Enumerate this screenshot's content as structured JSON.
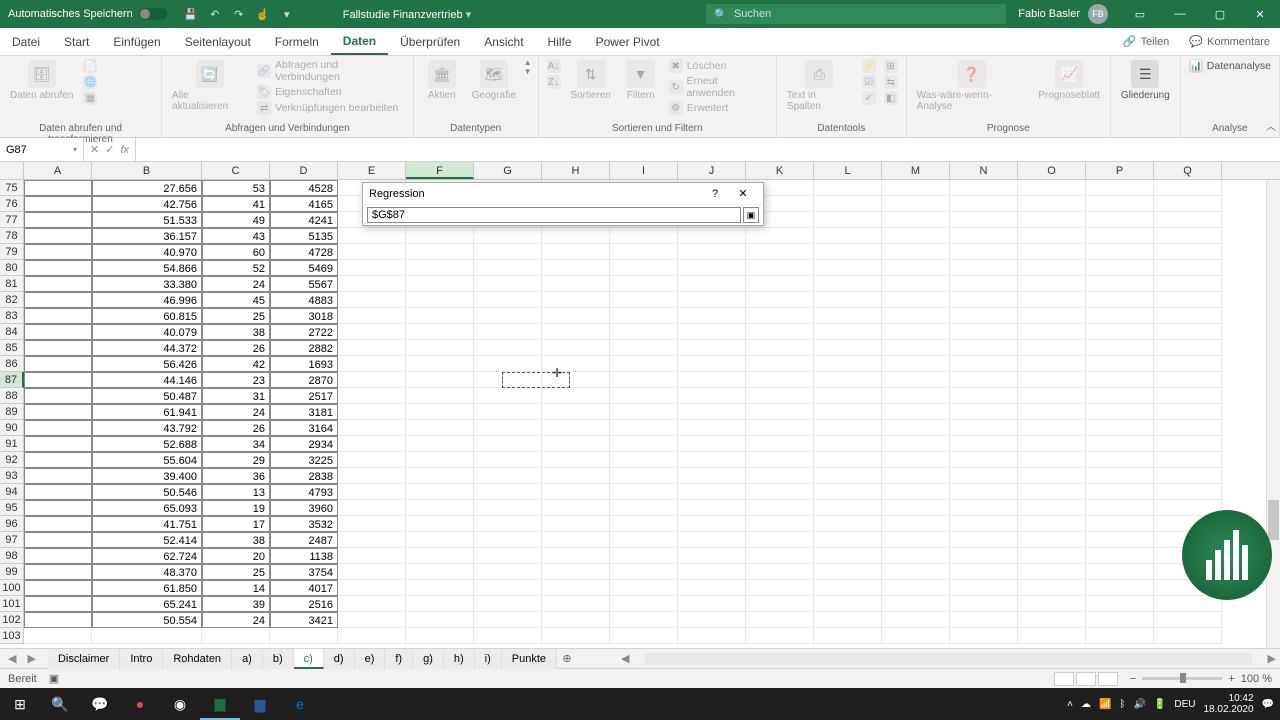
{
  "titlebar": {
    "autosave": "Automatisches Speichern",
    "doc_title": "Fallstudie Finanzvertrieb",
    "search_placeholder": "Suchen",
    "user_name": "Fabio Basler",
    "user_initials": "FB"
  },
  "ribbon_tabs": [
    "Datei",
    "Start",
    "Einfügen",
    "Seitenlayout",
    "Formeln",
    "Daten",
    "Überprüfen",
    "Ansicht",
    "Hilfe",
    "Power Pivot"
  ],
  "active_tab": "Daten",
  "share": "Teilen",
  "comments": "Kommentare",
  "ribbon": {
    "g1": {
      "b1": "Daten abrufen",
      "b2": "",
      "label": "Daten abrufen und transformieren"
    },
    "g2": {
      "b1": "Alle aktualisieren",
      "s1": "Abfragen und Verbindungen",
      "s2": "Eigenschaften",
      "s3": "Verknüpfungen bearbeiten",
      "label": "Abfragen und Verbindungen"
    },
    "g3": {
      "b1": "Aktien",
      "b2": "Geografie",
      "label": "Datentypen"
    },
    "g4": {
      "b1": "Sortieren",
      "b2": "Filtern",
      "s1": "Löschen",
      "s2": "Erneut anwenden",
      "s3": "Erweitert",
      "label": "Sortieren und Filtern"
    },
    "g5": {
      "b1": "Text in Spalten",
      "label": "Datentools"
    },
    "g6": {
      "b1": "Was-wäre-wenn-Analyse",
      "b2": "Prognoseblatt",
      "label": "Prognose"
    },
    "g7": {
      "b1": "Gliederung",
      "label": ""
    },
    "g8": {
      "s1": "Datenanalyse",
      "label": "Analyse"
    }
  },
  "namebox": "G87",
  "cols": [
    "A",
    "B",
    "C",
    "D",
    "E",
    "F",
    "G",
    "H",
    "I",
    "J",
    "K",
    "L",
    "M",
    "N",
    "O",
    "P",
    "Q"
  ],
  "col_widths": {
    "A": 68,
    "B": 110,
    "C": 68,
    "D": 68,
    "default": 68
  },
  "first_row": 75,
  "rows": [
    {
      "B": "27.656",
      "C": "53",
      "D": "4528"
    },
    {
      "B": "42.756",
      "C": "41",
      "D": "4165"
    },
    {
      "B": "51.533",
      "C": "49",
      "D": "4241"
    },
    {
      "B": "36.157",
      "C": "43",
      "D": "5135"
    },
    {
      "B": "40.970",
      "C": "60",
      "D": "4728"
    },
    {
      "B": "54.866",
      "C": "52",
      "D": "5469"
    },
    {
      "B": "33.380",
      "C": "24",
      "D": "5567"
    },
    {
      "B": "46.996",
      "C": "45",
      "D": "4883"
    },
    {
      "B": "60.815",
      "C": "25",
      "D": "3018"
    },
    {
      "B": "40.079",
      "C": "38",
      "D": "2722"
    },
    {
      "B": "44.372",
      "C": "26",
      "D": "2882"
    },
    {
      "B": "56.426",
      "C": "42",
      "D": "1693"
    },
    {
      "B": "44.146",
      "C": "23",
      "D": "2870"
    },
    {
      "B": "50.487",
      "C": "31",
      "D": "2517"
    },
    {
      "B": "61.941",
      "C": "24",
      "D": "3181"
    },
    {
      "B": "43.792",
      "C": "26",
      "D": "3164"
    },
    {
      "B": "52.688",
      "C": "34",
      "D": "2934"
    },
    {
      "B": "55.604",
      "C": "29",
      "D": "3225"
    },
    {
      "B": "39.400",
      "C": "36",
      "D": "2838"
    },
    {
      "B": "50.546",
      "C": "13",
      "D": "4793"
    },
    {
      "B": "65.093",
      "C": "19",
      "D": "3960"
    },
    {
      "B": "41.751",
      "C": "17",
      "D": "3532"
    },
    {
      "B": "52.414",
      "C": "38",
      "D": "2487"
    },
    {
      "B": "62.724",
      "C": "20",
      "D": "1138"
    },
    {
      "B": "48.370",
      "C": "25",
      "D": "3754"
    },
    {
      "B": "61.850",
      "C": "14",
      "D": "4017"
    },
    {
      "B": "65.241",
      "C": "39",
      "D": "2516"
    },
    {
      "B": "50.554",
      "C": "24",
      "D": "3421"
    },
    {
      "B": "",
      "C": "",
      "D": ""
    }
  ],
  "dialog": {
    "title": "Regression",
    "value": "$G$87"
  },
  "sheets": [
    "Disclaimer",
    "Intro",
    "Rohdaten",
    "a)",
    "b)",
    "c)",
    "d)",
    "e)",
    "f)",
    "g)",
    "h)",
    "i)",
    "Punkte"
  ],
  "active_sheet": "c)",
  "status": {
    "ready": "Bereit",
    "zoom": "100 %"
  },
  "tray": {
    "time": "10:42",
    "date": "18.02.2020",
    "lang": "DEU"
  }
}
